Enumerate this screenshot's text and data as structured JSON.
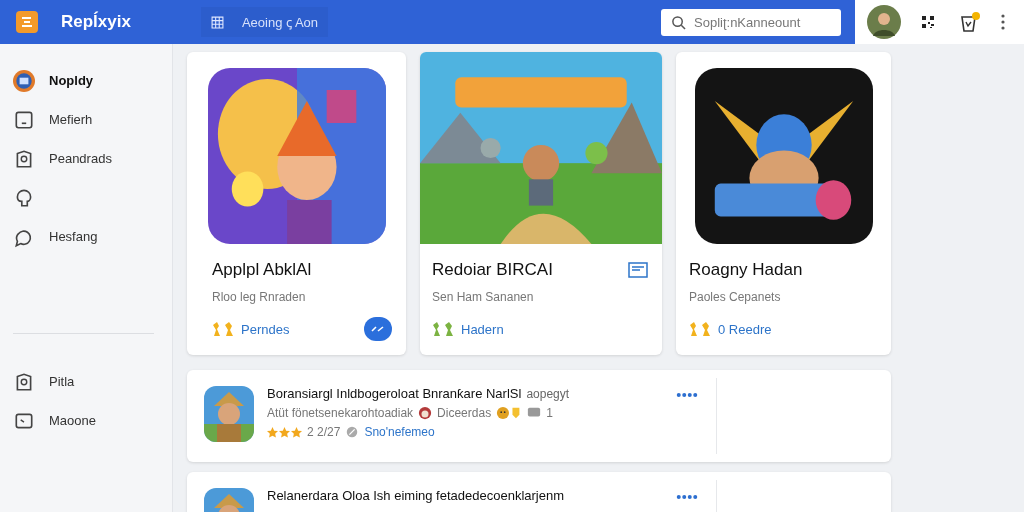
{
  "topbar": {
    "app_name": "Repĺxyix",
    "section": "Aeoing ꞔ Aon",
    "search": {
      "placeholder": "Sopliʈ:nKanneount"
    }
  },
  "sidebar": {
    "items": [
      {
        "label": "Nopldy",
        "selected": true
      },
      {
        "label": "Mefierh",
        "selected": false
      },
      {
        "label": "Peandrads",
        "selected": false
      },
      {
        "selected": false
      },
      {
        "label": "Hesfang",
        "selected": false
      }
    ],
    "bottom_items": [
      {
        "label": "Pitla",
        "selected": false
      },
      {
        "label": "Maoone",
        "selected": false
      }
    ]
  },
  "cards": [
    {
      "kind": "icon",
      "title": "Applpl AbklAl",
      "subtitle": "Rloo leg Rnraden",
      "link": "Perndes",
      "badge": {
        "color": "#f2b21d"
      },
      "accessory": {
        "kind": "button"
      }
    },
    {
      "kind": "banner",
      "title": "Redoiar BIRCAI",
      "subtitle": "Sen Ham Sananen",
      "link": "Hadern",
      "badge": {
        "color": "#7cb342"
      },
      "accessory": {
        "kind": "icon"
      }
    },
    {
      "kind": "icon",
      "title": "Roagny Hadan",
      "subtitle": "Paoles Cepanets",
      "link": "0 Reedre",
      "badge": {
        "color": "#f2b21d"
      }
    }
  ],
  "list": [
    {
      "title": "Boransiargl Inldbogeroloat Bnranƙare NarlSl",
      "title_suffix": "aopegyt",
      "detail": "Atüt fönetsenekarohtoadiak",
      "tag": "Diceerdas",
      "count": "1",
      "stars": 3,
      "rating": "2 2/27",
      "link": "Sno'nefemeo"
    },
    {
      "title": "Relanerdara Oloa Ish eiming fetadedecoenklarjenm"
    }
  ]
}
